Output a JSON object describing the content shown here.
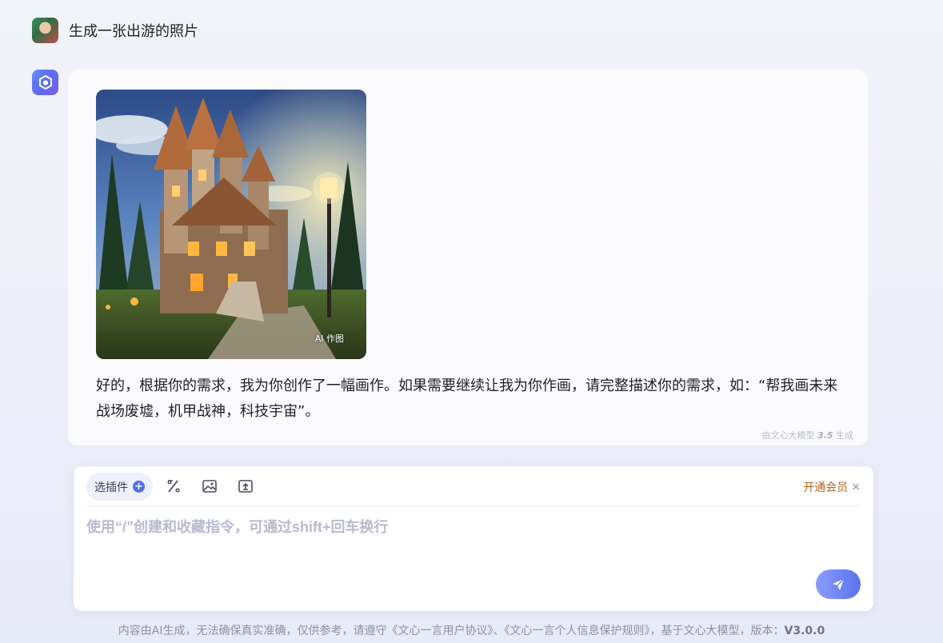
{
  "user": {
    "message": "生成一张出游的照片"
  },
  "answer": {
    "image_badge": "AI 作图",
    "text": "好的，根据你的需求，我为你创作了一幅画作。如果需要继续让我为你作画，请完整描述你的需求，如：“帮我画未来战场废墟，机甲战神，科技宇宙”。",
    "model_note_prefix": "由文心大模型 ",
    "model_note_version": "3.5",
    "model_note_suffix": " 生成"
  },
  "input": {
    "plugin_label": "选插件",
    "plugin_plus": "+",
    "vip_label": "开通会员",
    "vip_close": "×",
    "placeholder": "使用“/”创建和收藏指令，可通过shift+回车换行"
  },
  "footer": {
    "text": "内容由AI生成，无法确保真实准确，仅供参考，请遵守《文心一言用户协议》、《文心一言个人信息保护规则》，基于文心大模型，版本：",
    "version": "V3.0.0"
  },
  "colors": {
    "accent": "#4e6ef2",
    "vip": "#b4651d"
  }
}
